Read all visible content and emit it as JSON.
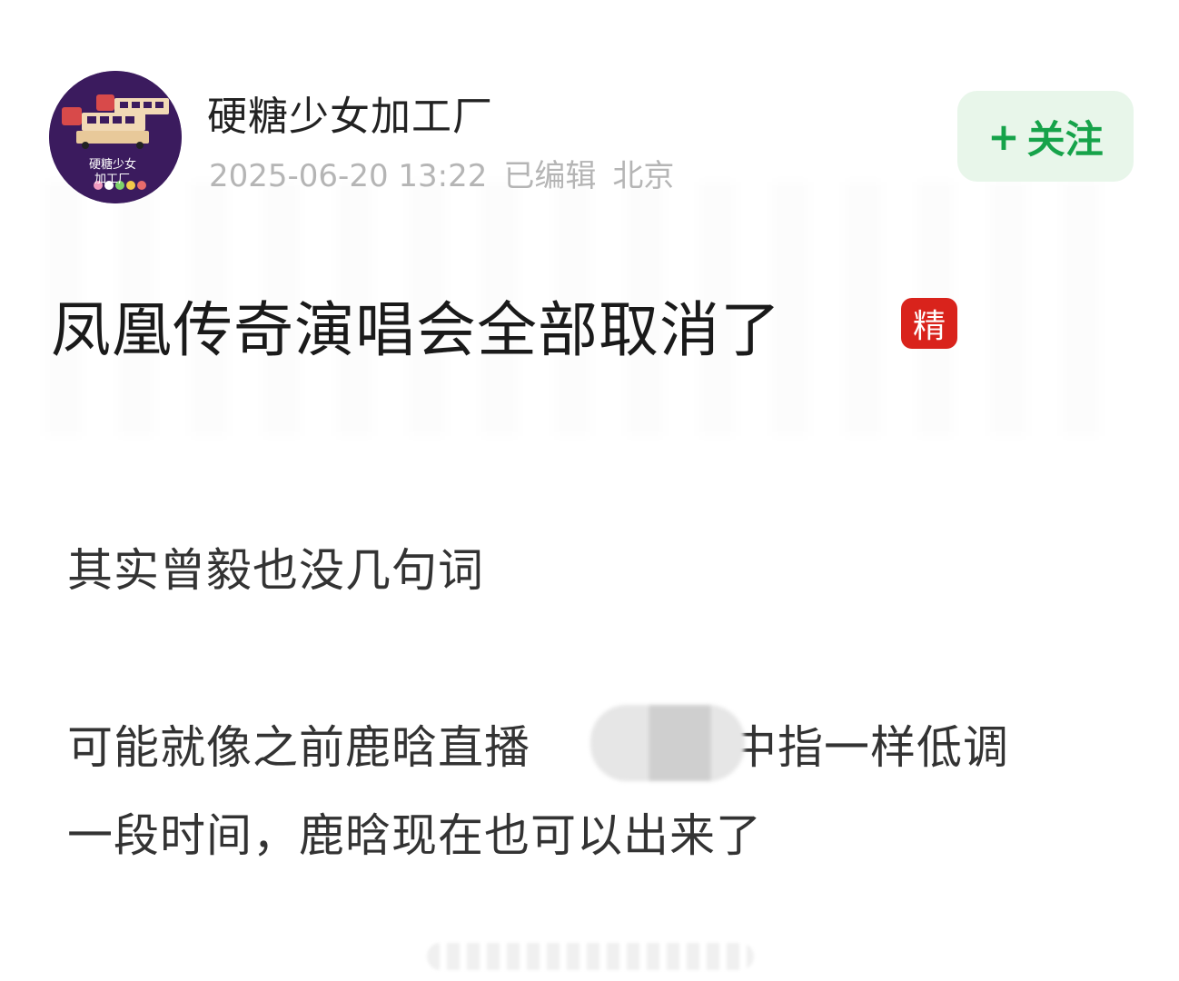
{
  "author": {
    "name": "硬糖少女加工厂",
    "avatar_text_line1": "硬糖少女",
    "avatar_text_line2": "加工厂"
  },
  "meta": {
    "datetime": "2025-06-20 13:22",
    "edited": "已编辑",
    "location": "北京"
  },
  "follow": {
    "plus": "+",
    "label": "关注"
  },
  "post": {
    "title": "凤凰传奇演唱会全部取消了",
    "badge": "精",
    "paragraph1": "其实曾毅也没几句词",
    "paragraph2_line1_a": "可能就像之前鹿晗直播",
    "paragraph2_line1_b": "竖中指一样低调",
    "paragraph2_line2": "一段时间，鹿晗现在也可以出来了"
  },
  "colors": {
    "accent_green": "#16a34a",
    "follow_bg": "#e8f6ea",
    "badge_red": "#d9231c",
    "meta_gray": "#b5b5b5"
  }
}
